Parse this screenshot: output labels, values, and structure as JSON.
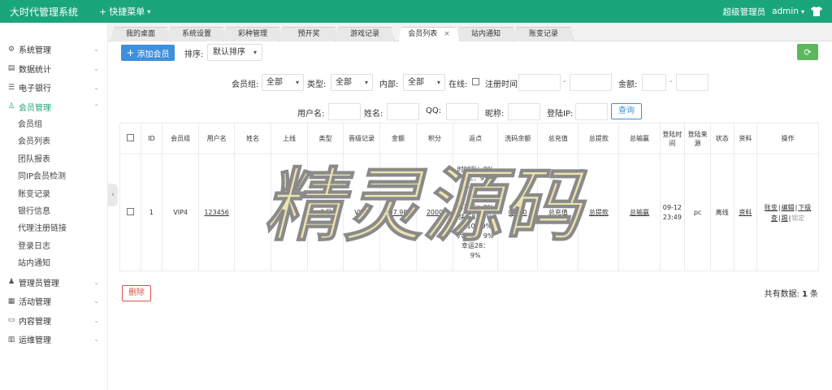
{
  "header": {
    "title": "大时代管理系统",
    "quick_menu": "快捷菜单",
    "role": "超级管理员",
    "user": "admin"
  },
  "sidebar": {
    "groups": [
      {
        "label": "系统管理",
        "icon": "gear-icon"
      },
      {
        "label": "数据统计",
        "icon": "chart-icon"
      },
      {
        "label": "电子银行",
        "icon": "list-icon"
      },
      {
        "label": "会员管理",
        "icon": "user-icon",
        "active": true
      },
      {
        "label": "管理员管理",
        "icon": "admin-icon"
      },
      {
        "label": "活动管理",
        "icon": "calendar-icon"
      },
      {
        "label": "内容管理",
        "icon": "folder-icon"
      },
      {
        "label": "运维管理",
        "icon": "server-icon"
      }
    ],
    "member_items": [
      "会员组",
      "会员列表",
      "团队报表",
      "同IP会员检测",
      "账变记录",
      "银行信息",
      "代理注册链接",
      "登录日志",
      "站内通知"
    ]
  },
  "tabs": [
    {
      "label": "我的桌面"
    },
    {
      "label": "系统设置"
    },
    {
      "label": "彩种管理"
    },
    {
      "label": "预开奖"
    },
    {
      "label": "游戏记录"
    },
    {
      "label": "会员列表",
      "active": true
    },
    {
      "label": "站内通知"
    },
    {
      "label": "账变记录"
    }
  ],
  "toolbar": {
    "add_label": "添加会员",
    "sort_label": "排序:",
    "sort_value": "默认排序"
  },
  "filters": {
    "group_label": "会员组:",
    "group_value": "全部",
    "type_label": "类型:",
    "type_value": "全部",
    "internal_label": "内部:",
    "internal_value": "全部",
    "online_label": "在线:",
    "regtime_label": "注册时间:",
    "amount_label": "金额:",
    "username_label": "用户名:",
    "name_label": "姓名:",
    "qq_label": "QQ:",
    "nickname_label": "昵称:",
    "loginip_label": "登陆IP:",
    "query_label": "查询"
  },
  "table": {
    "columns": [
      "ID",
      "会员组",
      "用户名",
      "姓名",
      "上线",
      "类型",
      "晋级记录",
      "金额",
      "积分",
      "返点",
      "洗码余额",
      "总充值",
      "总提款",
      "总输赢",
      "登陆时间",
      "登陆来源",
      "状态",
      "资料",
      "操作"
    ],
    "rows": [
      {
        "id": "1",
        "group": "VIP4",
        "username": "123456",
        "name": "",
        "upline": "",
        "type": "会员",
        "promotion": "VIP1",
        "amount": "597.980",
        "points": "2000",
        "rebates": [
          "时时彩：9%",
          "快三：9%",
          "十一选五：",
          "9%",
          "排列三：9%",
          "快乐8：9%",
          "pk10：9%",
          "六合彩：9%",
          "幸运28：",
          "9%"
        ],
        "wash_balance": "0.000",
        "total_recharge": "总充值",
        "total_withdraw": "总提款",
        "total_winloss": "总输赢",
        "login_time_1": "09-12",
        "login_time_2": "23:49",
        "login_source": "pc",
        "status": "离线",
        "profile": "资料",
        "ops": {
          "change": "账变",
          "edit": "编辑",
          "downline": "下级",
          "downline_2": "查",
          "kick": "踢",
          "lock": "锁定"
        }
      }
    ]
  },
  "footer": {
    "delete_label": "删除",
    "total_label": "共有数据:",
    "total_count": "1",
    "total_unit": "条"
  },
  "watermark": {
    "text": "精灵源码"
  },
  "colors": {
    "brand": "#1aa67a",
    "primary": "#3f8fdc",
    "danger": "#d9534f",
    "success": "#5cb85c"
  }
}
